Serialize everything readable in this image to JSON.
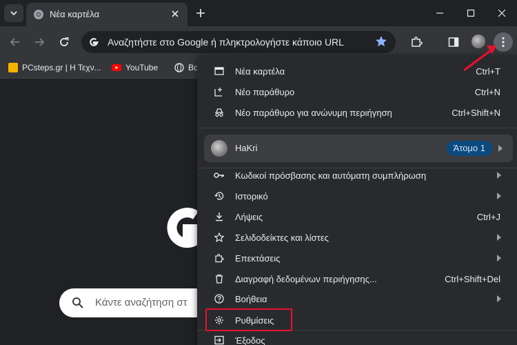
{
  "window": {
    "tab_title": "Νέα καρτέλα"
  },
  "toolbar": {
    "omnibox_text": "Αναζητήστε στο Google ή πληκτρολογήστε κάποιο URL"
  },
  "bookmarks": [
    {
      "label": "PCsteps.gr | Η Τεχν...",
      "color": "#f4b400"
    },
    {
      "label": "YouTube",
      "color": "#ff0000"
    },
    {
      "label": "Bo",
      "color": "#e8eaed"
    }
  ],
  "page": {
    "search_placeholder": "Κάντε αναζήτηση στ"
  },
  "menu": {
    "top_items": [
      {
        "label": "Νέα καρτέλα",
        "shortcut": "Ctrl+T",
        "icon": "new-tab-icon"
      },
      {
        "label": "Νέο παράθυρο",
        "shortcut": "Ctrl+N",
        "icon": "new-window-icon"
      },
      {
        "label": "Νέο παράθυρο για ανώνυμη περιήγηση",
        "shortcut": "Ctrl+Shift+N",
        "icon": "incognito-icon"
      }
    ],
    "profile": {
      "name": "HaKri",
      "badge": "Άτομο 1"
    },
    "items": [
      {
        "label": "Κωδικοί πρόσβασης και αυτόματη συμπλήρωση",
        "shortcut": "",
        "submenu": true,
        "icon": "key-icon"
      },
      {
        "label": "Ιστορικό",
        "shortcut": "",
        "submenu": true,
        "icon": "history-icon"
      },
      {
        "label": "Λήψεις",
        "shortcut": "Ctrl+J",
        "submenu": false,
        "icon": "download-icon"
      },
      {
        "label": "Σελιδοδείκτες και λίστες",
        "shortcut": "",
        "submenu": true,
        "icon": "star-icon"
      },
      {
        "label": "Επεκτάσεις",
        "shortcut": "",
        "submenu": true,
        "icon": "extension-icon"
      },
      {
        "label": "Διαγραφή δεδομένων περιήγησης...",
        "shortcut": "Ctrl+Shift+Del",
        "submenu": false,
        "icon": "trash-icon"
      },
      {
        "label": "Βοήθεια",
        "shortcut": "",
        "submenu": true,
        "icon": "help-icon"
      },
      {
        "label": "Ρυθμίσεις",
        "shortcut": "",
        "submenu": false,
        "icon": "gear-icon"
      },
      {
        "label": "Έξοδος",
        "shortcut": "",
        "submenu": false,
        "icon": "exit-icon"
      }
    ]
  },
  "colors": {
    "highlight": "#e8112d",
    "badge_bg": "#0b4a7e"
  }
}
